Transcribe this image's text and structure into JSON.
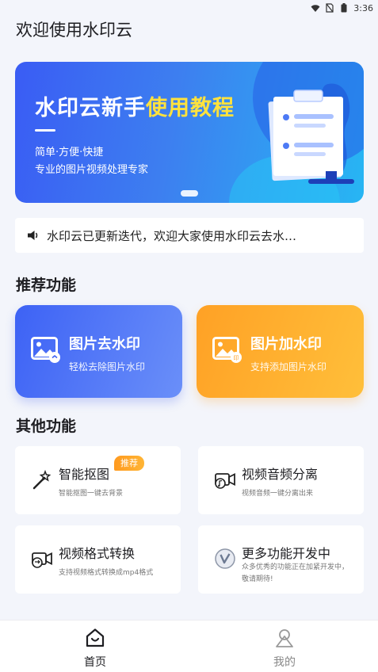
{
  "status_bar": {
    "time": "3:36"
  },
  "app_title": "欢迎使用水印云",
  "banner": {
    "title_part1": "水印云新手",
    "title_part2": "使用教程",
    "subtitle1": "简单·方便·快捷",
    "subtitle2": "专业的图片视频处理专家"
  },
  "notice": {
    "text": "水印云已更新迭代，欢迎大家使用水印云去水…"
  },
  "recommended": {
    "title": "推荐功能",
    "cards": [
      {
        "title": "图片去水印",
        "subtitle": "轻松去除图片水印",
        "icon": "image-remove-watermark-icon"
      },
      {
        "title": "图片加水印",
        "subtitle": "支持添加图片水印",
        "icon": "image-add-watermark-icon"
      }
    ]
  },
  "other": {
    "title": "其他功能",
    "items": [
      {
        "title": "智能抠图",
        "subtitle": "智能抠图一键去背景",
        "badge": "推荐",
        "icon": "magic-wand-icon"
      },
      {
        "title": "视频音频分离",
        "subtitle": "视频音频一键分离出来",
        "icon": "video-audio-icon"
      },
      {
        "title": "视频格式转换",
        "subtitle": "支持视频格式转换成mp4格式",
        "icon": "video-convert-icon"
      },
      {
        "title": "更多功能开发中",
        "subtitle": "众多优秀的功能正在加紧开发中，敬请期待!",
        "icon": "more-features-icon"
      }
    ]
  },
  "bottom_nav": {
    "items": [
      {
        "label": "首页",
        "icon": "home-icon",
        "active": true
      },
      {
        "label": "我的",
        "icon": "profile-icon",
        "active": false
      }
    ]
  },
  "colors": {
    "background": "#f3f5fb",
    "accent_blue": "#3d62f5",
    "accent_orange": "#ffa125",
    "highlight_yellow": "#ffe23d"
  }
}
